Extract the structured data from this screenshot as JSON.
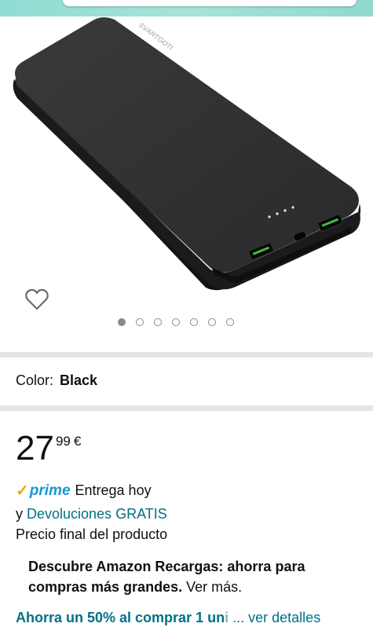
{
  "colors": {
    "link": "#007185",
    "prime_check": "#f0a30a",
    "prime_word": "#1a98d5",
    "separator": "#e3e6e6"
  },
  "product": {
    "brand_text": "SVARTGOTI",
    "image_count": 7,
    "active_image": 0,
    "favorite_icon": "heart-outline-icon"
  },
  "variant": {
    "color_label": "Color:",
    "color_value": "Black"
  },
  "price": {
    "whole": "27",
    "fraction": "99",
    "currency": "€"
  },
  "delivery": {
    "prime": "prime",
    "text": "Entrega hoy"
  },
  "returns": {
    "prefix": "y",
    "link": "Devoluciones GRATIS"
  },
  "final_price_note": "Precio final del producto",
  "promo": {
    "bold_text": "Descubre Amazon Recargas: ahorra para compras más grandes.",
    "link_text": "Ver más."
  },
  "offer": {
    "text": "Ahorra un 50% al comprar 1 un",
    "faded": "i",
    "ellipsis": "...",
    "details": "ver detalles"
  }
}
